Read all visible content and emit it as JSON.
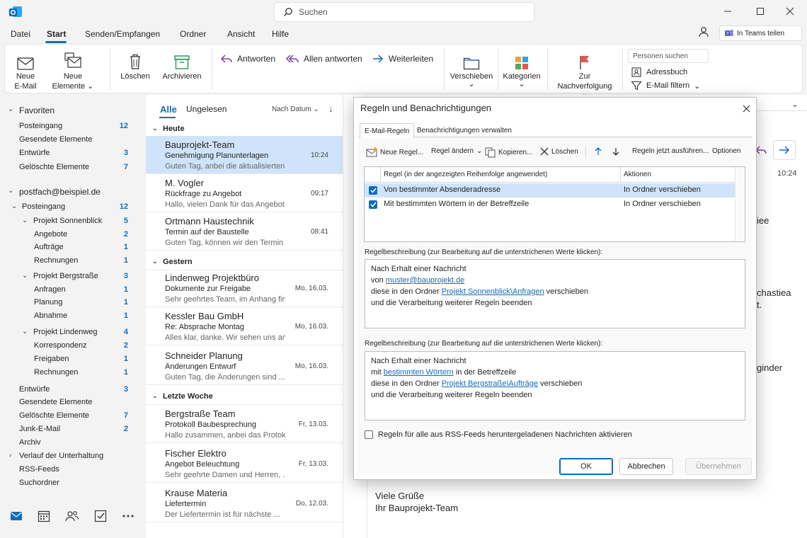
{
  "titlebar": {
    "search_placeholder": "Suchen"
  },
  "menu": {
    "items": [
      "Datei",
      "Start",
      "Senden/Empfangen",
      "Ordner",
      "Ansicht",
      "Hilfe"
    ],
    "active": "Start",
    "teams_button": "In Teams teilen"
  },
  "ribbon": {
    "new_email": [
      "Neue",
      "E-Mail"
    ],
    "new_items": [
      "Neue",
      "Elemente"
    ],
    "delete": "Löschen",
    "archive": "Archivieren",
    "reply": "Antworten",
    "reply_all": "Allen antworten",
    "forward": "Weiterleiten",
    "move": "Verschieben",
    "categories": "Kategorien",
    "followup": "Zur Nachverfolgung",
    "people_search": "Personen suchen",
    "address_book": "Adressbuch",
    "filter_email": "E-Mail filtern"
  },
  "folders": {
    "favorites_label": "Favoriten",
    "favorites": [
      {
        "name": "Posteingang",
        "count": "12"
      },
      {
        "name": "Gesendete Elemente",
        "count": ""
      },
      {
        "name": "Entwürfe",
        "count": "3"
      },
      {
        "name": "Gelöschte Elemente",
        "count": "7"
      }
    ],
    "account": "postfach@beispiel.de",
    "inbox": {
      "name": "Posteingang",
      "count": "12"
    },
    "projects": [
      {
        "name": "Projekt Sonnenblick",
        "count": "5",
        "children": [
          {
            "name": "Angebote",
            "count": "2"
          },
          {
            "name": "Aufträge",
            "count": "1"
          },
          {
            "name": "Rechnungen",
            "count": "1"
          }
        ]
      },
      {
        "name": "Projekt Bergstraße",
        "count": "3",
        "children": [
          {
            "name": "Anfragen",
            "count": "1"
          },
          {
            "name": "Planung",
            "count": "1"
          },
          {
            "name": "Abnahme",
            "count": "1"
          }
        ]
      },
      {
        "name": "Projekt Lindenweg",
        "count": "4",
        "children": [
          {
            "name": "Korrespondenz",
            "count": "2"
          },
          {
            "name": "Freigaben",
            "count": "1"
          },
          {
            "name": "Rechnungen",
            "count": "1"
          }
        ]
      }
    ],
    "others": [
      {
        "name": "Entwürfe",
        "count": "3"
      },
      {
        "name": "Gesendete Elemente",
        "count": ""
      },
      {
        "name": "Gelöschte Elemente",
        "count": "7"
      },
      {
        "name": "Junk-E-Mail",
        "count": "2"
      },
      {
        "name": "Archiv",
        "count": ""
      },
      {
        "name": "Verlauf der Unterhaltung",
        "count": ""
      },
      {
        "name": "RSS-Feeds",
        "count": ""
      },
      {
        "name": "Suchordner",
        "count": ""
      }
    ]
  },
  "list": {
    "tab_all": "Alle",
    "tab_unread": "Ungelesen",
    "sort": "Nach Datum",
    "groups": [
      {
        "label": "Heute",
        "messages": [
          {
            "sender": "Bauprojekt-Team",
            "subject": "Genehmigung Planunterlagen",
            "preview": "Guten Tag, anbei die aktualisierten...",
            "time": "10:24",
            "selected": true
          },
          {
            "sender": "M. Vogler",
            "subject": "Rückfrage zu Angebot",
            "preview": "Hallo, vielen Dank für das Angebot...",
            "time": "09:17"
          },
          {
            "sender": "Ortmann Haustechnik",
            "subject": "Termin auf der Baustelle",
            "preview": "Guten Tag, können wir den Termin ...",
            "time": "08:41"
          }
        ]
      },
      {
        "label": "Gestern",
        "messages": [
          {
            "sender": "Lindenweg Projektbüro",
            "subject": "Dokumente zur Freigabe",
            "preview": "Sehr geehrtes Team, im Anhang fin...",
            "time": "Mo, 16.03."
          },
          {
            "sender": "Kessler Bau GmbH",
            "subject": "Re: Absprache Montag",
            "preview": "Alles klar, danke. Wir sehen uns am ...",
            "time": "Mo, 16.03."
          },
          {
            "sender": "Schneider Planung",
            "subject": "Änderungen Entwurf",
            "preview": "Guten Tag, die Änderungen sind ...",
            "time": "Mo, 16.03."
          }
        ]
      },
      {
        "label": "Letzte Woche",
        "messages": [
          {
            "sender": "Bergstraße Team",
            "subject": "Protokoll Baubesprechung",
            "preview": "Hallo zusammen, anbei das Protok...",
            "time": "Fr, 13.03."
          },
          {
            "sender": "Fischer Elektro",
            "subject": "Angebot Beleuchtung",
            "preview": "Sehr geehrte Damen und Herren, ...",
            "time": "Fr, 13.03."
          },
          {
            "sender": "Krause Materia",
            "subject": "Liefertermin",
            "preview": "Der Liefertermin ist für nächste ...",
            "time": "Do, 12.03."
          }
        ]
      }
    ]
  },
  "reading": {
    "time": "10:24",
    "frag1": "iee",
    "frag2": "chastiea",
    "frag3": "t.",
    "frag4": "ginder",
    "closing1": "Viele Grüße",
    "closing2": "Ihr Bauprojekt-Team"
  },
  "dialog": {
    "title": "Regeln und Benachrichtigungen",
    "tabs": [
      "E-Mail-Regeln",
      "Benachrichtigungen verwalten"
    ],
    "toolbar": {
      "new_rule": "Neue Regel...",
      "change_rule": "Regel ändern",
      "copy": "Kopieren...",
      "delete": "Löschen",
      "run_rules": "Regeln jetzt ausführen...",
      "options": "Optionen"
    },
    "columns": {
      "rule": "Regel (in der angezeigten Reihenfolge angewendet)",
      "actions": "Aktionen"
    },
    "rules": [
      {
        "name": "Von bestimmter Absenderadresse",
        "action": "In Ordner verschieben",
        "checked": true,
        "selected": true
      },
      {
        "name": "Mit bestimmten Wörtern in der Betreffzeile",
        "action": "In Ordner verschieben",
        "checked": true,
        "selected": false
      }
    ],
    "desc_label": "Regelbeschreibung (zur Bearbeitung auf die unterstrichenen Werte klicken):",
    "desc1": {
      "line1": "Nach Erhalt einer Nachricht",
      "l2_pre": "von ",
      "l2_link": "muster@bauprojekt.de",
      "l3_pre": "diese in den Ordner ",
      "l3_link": "Projekt Sonnenblick\\Anfragen",
      "l3_post": " verschieben",
      "line4": "und die Verarbeitung weiterer Regeln beenden"
    },
    "desc2": {
      "line1": "Nach Erhalt einer Nachricht",
      "l2_pre": "mit ",
      "l2_link": "bestimmten Wörtern",
      "l2_post": " in der Betreffzeile",
      "l3_pre": "diese in den Ordner ",
      "l3_link": "Projekt Bergstraße\\Aufträge",
      "l3_post": " verschieben",
      "line4": "und die Verarbeitung weiterer Regeln beenden"
    },
    "rss_label": "Regeln für alle aus RSS-Feeds heruntergeladenen Nachrichten aktivieren",
    "buttons": {
      "ok": "OK",
      "cancel": "Abbrechen",
      "apply": "Übernehmen"
    }
  }
}
